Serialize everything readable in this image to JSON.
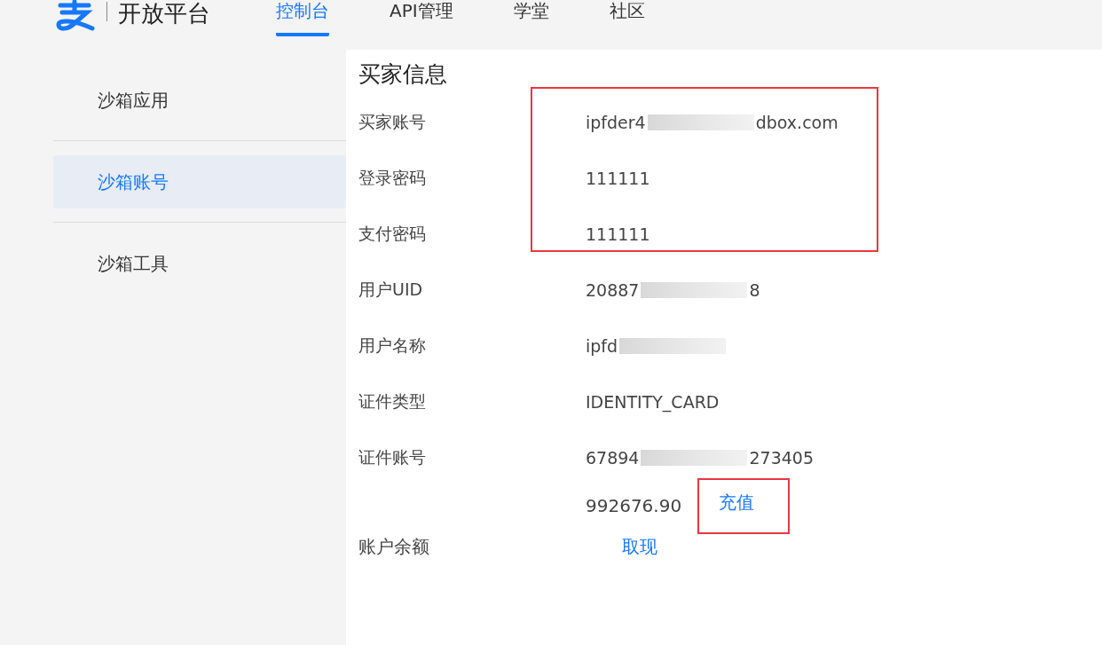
{
  "header": {
    "brand": "开放平台",
    "nav": [
      {
        "label": "控制台",
        "selected": true
      },
      {
        "label": "API管理",
        "selected": false
      },
      {
        "label": "学堂",
        "selected": false
      },
      {
        "label": "社区",
        "selected": false
      }
    ]
  },
  "sidebar": {
    "items": [
      {
        "label": "沙箱应用",
        "selected": false
      },
      {
        "label": "沙箱账号",
        "selected": true
      },
      {
        "label": "沙箱工具",
        "selected": false
      }
    ]
  },
  "section": {
    "title": "买家信息",
    "rows": [
      {
        "label": "买家账号",
        "value_start": "ipfder4",
        "value_end": "dbox.com",
        "blurred": true,
        "boxed": true
      },
      {
        "label": "登录密码",
        "value_start": "111111",
        "blurred": false,
        "boxed": true
      },
      {
        "label": "支付密码",
        "value_start": "111111",
        "blurred": false,
        "boxed": true
      },
      {
        "label": "用户UID",
        "value_start": "20887",
        "value_end": "8",
        "blurred": true,
        "boxed": false
      },
      {
        "label": "用户名称",
        "value_start": "ipfd",
        "blurred": true,
        "boxed": false
      },
      {
        "label": "证件类型",
        "value_start": "IDENTITY_CARD",
        "blurred": false,
        "boxed": false
      },
      {
        "label": "证件账号",
        "value_start": "67894",
        "value_end": "273405",
        "blurred": true,
        "boxed": false
      }
    ],
    "balance": {
      "label": "账户余额",
      "amount": "992676.90",
      "recharge": "充值",
      "recharge_boxed": true,
      "withdraw": "取现"
    }
  }
}
